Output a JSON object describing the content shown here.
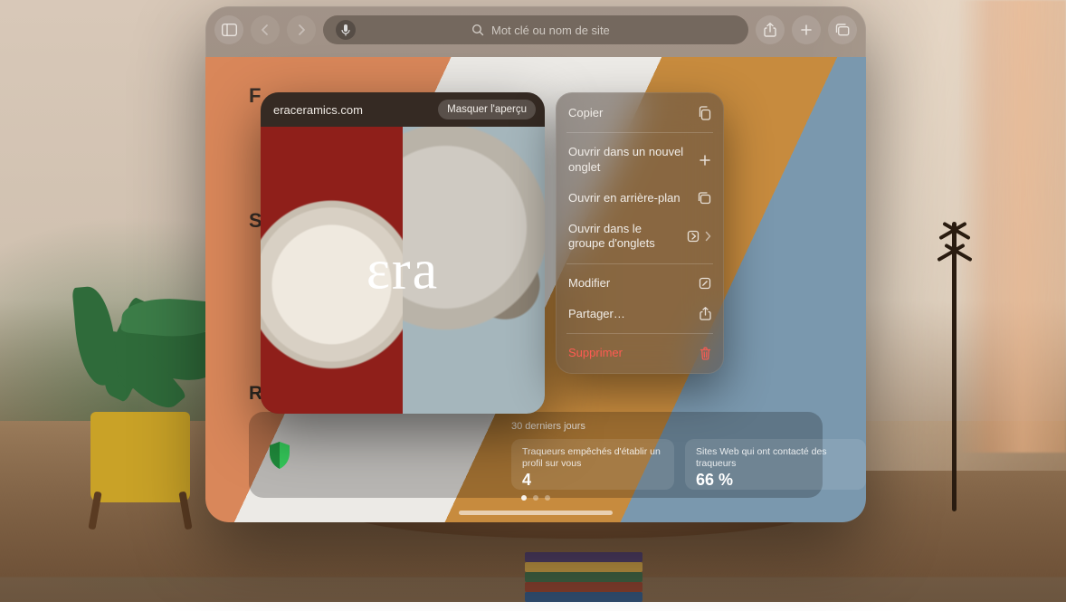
{
  "toolbar": {
    "search_placeholder": "Mot clé ou nom de site"
  },
  "sections": {
    "favorites_label_initial": "F",
    "second_label_initial": "S",
    "privacy_label": "Rapport de confidentialité"
  },
  "privacy": {
    "time_range": "30 derniers jours",
    "trackers_label": "Traqueurs empêchés d'établir un profil sur vous",
    "trackers_value": "4",
    "sites_label": "Sites Web qui ont contacté des traqueurs",
    "sites_value": "66 %"
  },
  "preview": {
    "domain": "eraceramics.com",
    "hide_label": "Masquer l'aperçu",
    "logo_text": "εra"
  },
  "menu": {
    "copy": "Copier",
    "open_new_tab": "Ouvrir dans un nouvel onglet",
    "open_background": "Ouvrir en arrière-plan",
    "open_tab_group": "Ouvrir dans le groupe d'onglets",
    "edit": "Modifier",
    "share": "Partager…",
    "delete": "Supprimer"
  }
}
